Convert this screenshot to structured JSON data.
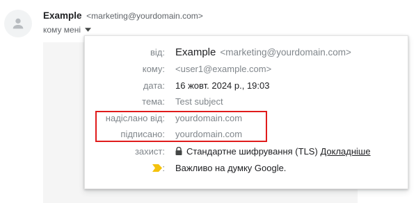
{
  "header": {
    "sender_name": "Example",
    "sender_email": "<marketing@yourdomain.com>",
    "recipient_text": "кому мені"
  },
  "details": {
    "from_label": "від:",
    "from_name": "Example",
    "from_email": "<marketing@yourdomain.com>",
    "to_label": "кому:",
    "to_value": "<user1@example.com>",
    "date_label": "дата:",
    "date_value": "16 жовт. 2024 р., 19:03",
    "subject_label": "тема:",
    "subject_value": "Test subject",
    "mailed_by_label": "надіслано від:",
    "mailed_by_value": "yourdomain.com",
    "signed_by_label": "підписано:",
    "signed_by_value": "yourdomain.com",
    "security_label": "захист:",
    "security_value": "Стандартне шифрування (TLS)",
    "security_link": "Докладніше",
    "importance_colon": ":",
    "importance_value": "Важливо на думку Google."
  },
  "icons": {
    "avatar": "person-icon",
    "caret": "caret-down-icon",
    "lock": "lock-icon",
    "importance": "importance-marker-icon"
  },
  "colors": {
    "highlight": "#e01b1b",
    "importance_marker": "#f4c20d",
    "label_grey": "#80868b"
  }
}
